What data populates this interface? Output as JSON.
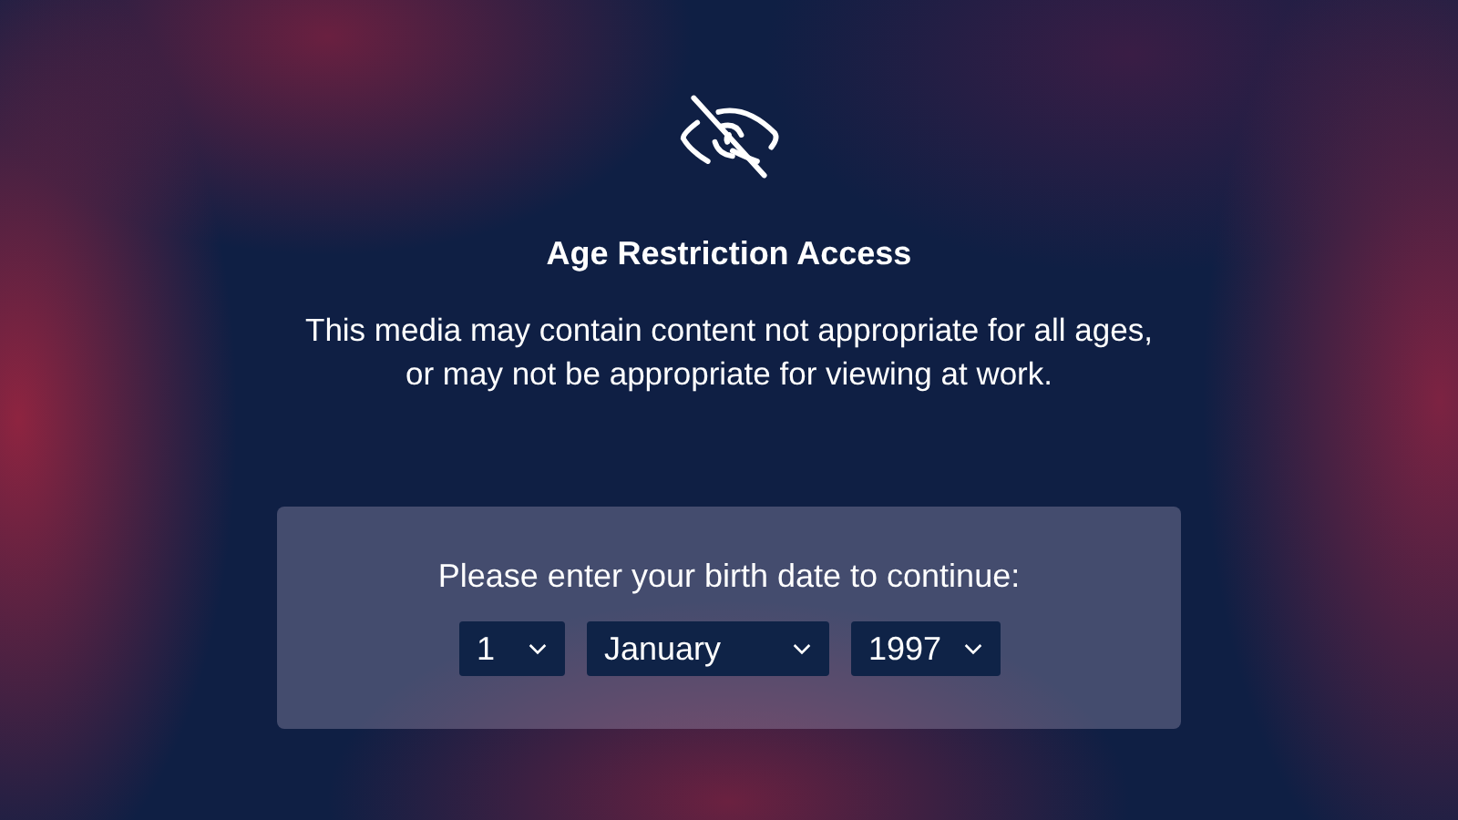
{
  "title": "Age Restriction Access",
  "message": "This media may contain content not appropriate for all ages, or may not be appropriate for viewing at work.",
  "form": {
    "prompt": "Please enter your birth date to continue:",
    "dropdowns": [
      {
        "kind": "day",
        "value": "1"
      },
      {
        "kind": "month",
        "value": "January"
      },
      {
        "kind": "year",
        "value": "1997"
      }
    ]
  }
}
